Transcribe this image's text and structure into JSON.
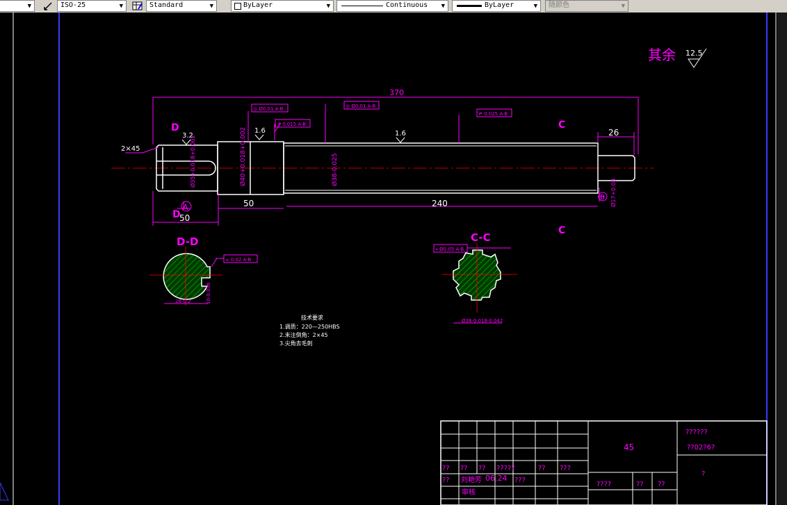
{
  "toolbar": {
    "dimstyle": "ISO-25",
    "tablestyle": "Standard",
    "layer_color": "ByLayer",
    "linetype": "Continuous",
    "lineweight": "ByLayer",
    "plotstyle": "随颜色"
  },
  "drawing": {
    "roughness_other_label": "其余",
    "roughness_other_value": "12.5",
    "overall_length": "370",
    "chamfer": "2×45",
    "section_d_top": "D",
    "section_d_bottom": "D",
    "section_c_top": "C",
    "section_c_bottom": "C",
    "roughness_left": "3.2",
    "roughness_mid1": "1.6",
    "roughness_mid2": "1.6",
    "length_right_end": "26",
    "length_50_left": "50",
    "length_50_mid": "50",
    "length_240": "240",
    "dia_40": "Ø40+0.018+0.002",
    "dia_38_main": "Ø38-0.025",
    "dia_35": "Ø35+0.018+0.002",
    "dia_17": "Ø17+0.08",
    "datum_a": "A",
    "datum_b": "B",
    "gtol_1": "◎ Ø0.01 A-B",
    "gtol_2": "↗ 0.015 A-B",
    "gtol_3": "◎ Ø0.01 A-B",
    "gtol_4": "↗ 0.025 A-B",
    "section_dd_title": "D-D",
    "section_cc_title": "C-C",
    "gtol_dd": "⌯ 0.02 A-B",
    "gtol_cc": "⌖ Ø0.05 A-B",
    "dd_width": "28-0.2",
    "dd_key": "10-0.036",
    "cc_dia": "Ø38-0.018-0.042",
    "tech_title": "技术要求",
    "tech_1": "1.调质：220—250HBS",
    "tech_2": "2.未注倒角：2×45",
    "tech_3": "3.尖角去毛刺"
  },
  "title_block": {
    "material": "45",
    "drawing_name": "??????",
    "drawing_number": "??02?6?",
    "row1": [
      "??",
      "??",
      "??",
      "?????",
      "??",
      "???"
    ],
    "designer": "刘艳芳",
    "date": "06.24",
    "col_mark": "???",
    "scale_label": "????",
    "sheet_label1": "??",
    "sheet_label2": "??",
    "approver": "审核",
    "question": "?"
  }
}
